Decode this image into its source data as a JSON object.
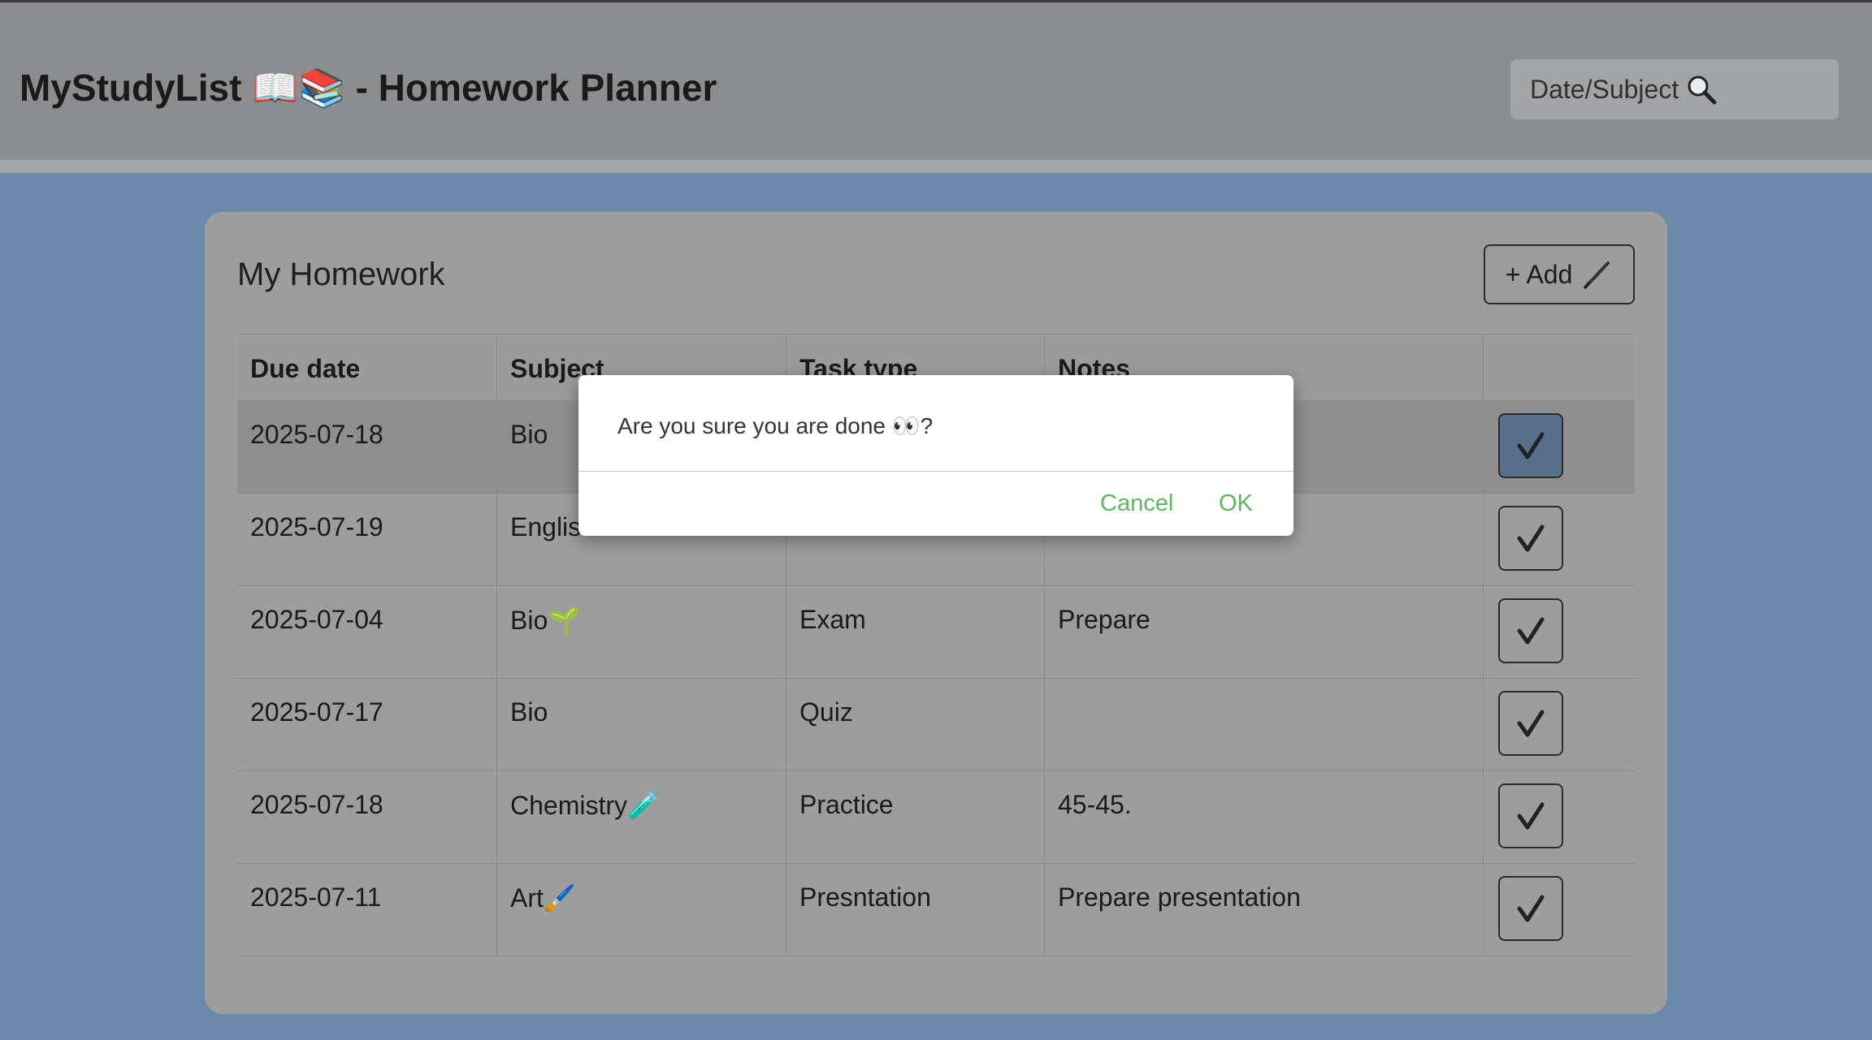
{
  "header": {
    "title": "MyStudyList 📖📚 - Homework Planner",
    "search_placeholder": "Date/Subject",
    "search_icon": "magnifier-icon"
  },
  "card": {
    "title": "My Homework",
    "add_label": "+ Add",
    "add_icon": "pen-icon"
  },
  "table": {
    "columns": [
      "Due date",
      "Subject",
      "Task type",
      "Notes",
      ""
    ],
    "rows": [
      {
        "due": "2025-07-18",
        "subject": "Bio",
        "task": "",
        "notes": "",
        "highlighted": true
      },
      {
        "due": "2025-07-19",
        "subject": "Englis",
        "task": "",
        "notes": "",
        "highlighted": false
      },
      {
        "due": "2025-07-04",
        "subject": "Bio🌱",
        "task": "Exam",
        "notes": "Prepare",
        "highlighted": false
      },
      {
        "due": "2025-07-17",
        "subject": "Bio",
        "task": "Quiz",
        "notes": "",
        "highlighted": false
      },
      {
        "due": "2025-07-18",
        "subject": "Chemistry🧪",
        "task": "Practice",
        "notes": "45-45.",
        "highlighted": false
      },
      {
        "due": "2025-07-11",
        "subject": "Art🖌️",
        "task": "Presntation",
        "notes": "Prepare presentation",
        "highlighted": false
      }
    ],
    "done_icon": "checkmark-icon"
  },
  "dialog": {
    "message": "Are you sure you are done 👀?",
    "cancel_label": "Cancel",
    "ok_label": "OK"
  },
  "colors": {
    "page_background": "#6b8aa9",
    "header_background": "#8c8d8f",
    "card_background": "#9d9d9e",
    "dialog_button": "#5cb85c",
    "active_check": "#59708c"
  }
}
